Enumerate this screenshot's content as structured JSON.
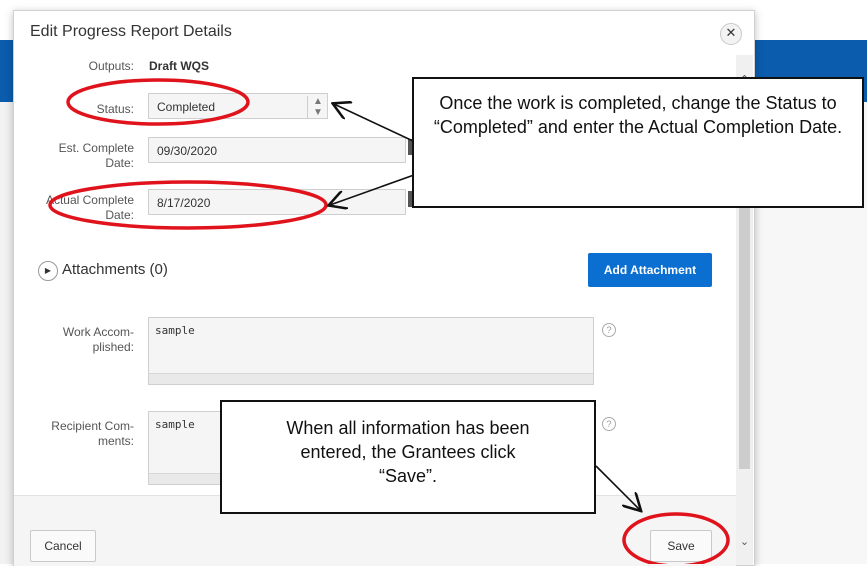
{
  "dialog": {
    "title": "Edit Progress Report Details",
    "close_icon": "close-icon"
  },
  "form": {
    "outputs_label": "Outputs:",
    "outputs_value": "Draft WQS",
    "status_label": "Status:",
    "status_value": "Completed",
    "est_label_1": "Est. Complete",
    "est_label_2": "Date:",
    "est_value": "09/30/2020",
    "actual_label_1": "Actual Complete",
    "actual_label_2": "Date:",
    "actual_value": "8/17/2020",
    "attachments_label": "Attachments (0)",
    "add_attachment_label": "Add Attachment",
    "work_label_1": "Work Accom-",
    "work_label_2": "plished:",
    "work_value": "sample",
    "recipient_label_1": "Recipient Com-",
    "recipient_label_2": "ments:",
    "recipient_value": "sample"
  },
  "footer": {
    "cancel_label": "Cancel",
    "save_label": "Save"
  },
  "annotations": {
    "callout_1": "Once the work is completed, change the Status to “Completed” and enter the Actual Completion Date.",
    "callout_2": "When all information has been entered, the Grantees click “Save”.",
    "highlight_color": "#e0121b"
  },
  "colors": {
    "primary_button": "#0a6fd1",
    "header_blue": "#0b5cad"
  }
}
